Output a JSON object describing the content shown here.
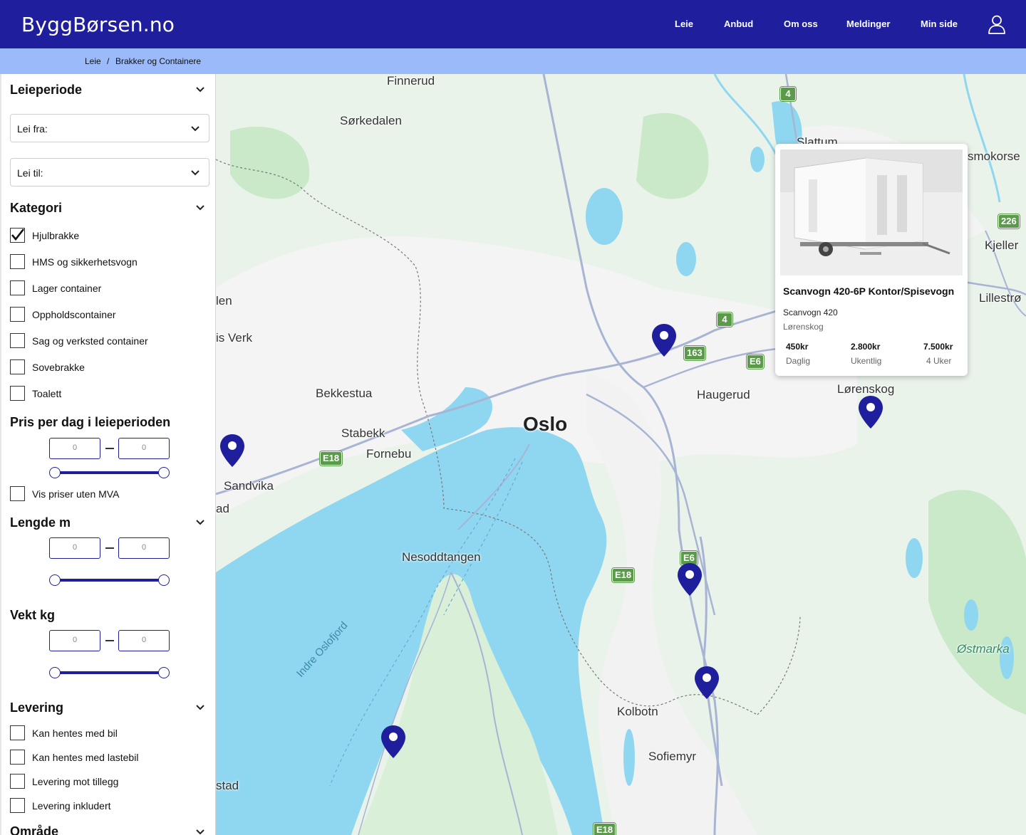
{
  "header": {
    "logo": "ByggBørsen.no",
    "nav": [
      "Leie",
      "Anbud",
      "Om oss",
      "Meldinger",
      "Min side"
    ]
  },
  "breadcrumb": {
    "items": [
      "Leie",
      "Brakker og Containere"
    ],
    "separator": "/"
  },
  "filters": {
    "rental_period": {
      "title": "Leieperiode",
      "from_label": "Lei fra:",
      "to_label": "Lei til:"
    },
    "category": {
      "title": "Kategori",
      "options": [
        {
          "label": "Hjulbrakke",
          "checked": true
        },
        {
          "label": "HMS og sikkerhetsvogn",
          "checked": false
        },
        {
          "label": "Lager container",
          "checked": false
        },
        {
          "label": "Oppholdscontainer",
          "checked": false
        },
        {
          "label": "Sag og verksted container",
          "checked": false
        },
        {
          "label": "Sovebrakke",
          "checked": false
        },
        {
          "label": "Toalett",
          "checked": false
        }
      ]
    },
    "price": {
      "title": "Pris per dag i leieperioden",
      "min": "0",
      "max": "0",
      "vat_label": "Vis priser uten MVA"
    },
    "length": {
      "title": "Lengde m",
      "min": "0",
      "max": "0"
    },
    "weight": {
      "title": "Vekt kg",
      "min": "0",
      "max": "0"
    },
    "delivery": {
      "title": "Levering",
      "options": [
        "Kan hentes med bil",
        "Kan hentes med lastebil",
        "Levering mot tillegg",
        "Levering inkludert"
      ]
    },
    "area": {
      "title": "Område"
    }
  },
  "map": {
    "places": [
      "Finnerud",
      "Sørkedalen",
      "Slattum",
      "smokorse",
      "Kjeller",
      "Lillestrø",
      "len",
      "is Verk",
      "Bekkestua",
      "Stabekk",
      "Fornebu",
      "Oslo",
      "Haugerud",
      "Lørenskog",
      "Sandvika",
      "ad",
      "Nesoddtangen",
      "Indre Oslofjord",
      "Kolbotn",
      "Sofiemyr",
      "stad",
      "Østmarka"
    ],
    "roads": [
      "4",
      "226",
      "4",
      "163",
      "E6",
      "E18",
      "E6",
      "E18",
      "E18"
    ]
  },
  "listing": {
    "title": "Scanvogn 420-6P Kontor/Spisevogn",
    "model": "Scanvogn 420",
    "location": "Lørenskog",
    "prices": [
      {
        "value": "450kr",
        "label": "Daglig"
      },
      {
        "value": "2.800kr",
        "label": "Ukentlig"
      },
      {
        "value": "7.500kr",
        "label": "4 Uker"
      }
    ]
  },
  "colors": {
    "header": "#1f1f9e",
    "breadcrumb_bar": "#9bbaf9",
    "accent": "#1f1f9e",
    "water": "#8fd7f0",
    "land": "#e9f3ea",
    "urban": "#f4f4f4",
    "road": "#a7b4d4",
    "highway_shield": "#5a9a4a"
  }
}
